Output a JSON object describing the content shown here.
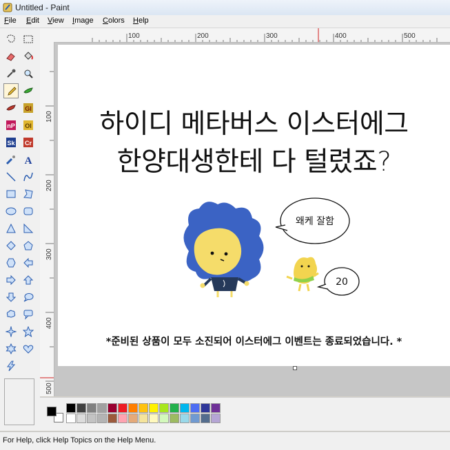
{
  "window": {
    "title": "Untitled - Paint"
  },
  "menu": [
    {
      "label": "File",
      "key": "F",
      "rest": "ile"
    },
    {
      "label": "Edit",
      "key": "E",
      "rest": "dit"
    },
    {
      "label": "View",
      "key": "V",
      "rest": "iew"
    },
    {
      "label": "Image",
      "key": "I",
      "rest": "mage"
    },
    {
      "label": "Colors",
      "key": "C",
      "rest": "olors"
    },
    {
      "label": "Help",
      "key": "H",
      "rest": "elp"
    }
  ],
  "tools": [
    {
      "name": "free-select",
      "icon": "free-select-icon"
    },
    {
      "name": "rect-select",
      "icon": "rect-select-icon"
    },
    {
      "name": "eraser",
      "icon": "eraser-icon"
    },
    {
      "name": "fill",
      "icon": "fill-bucket-icon"
    },
    {
      "name": "color-picker",
      "icon": "eyedropper-icon"
    },
    {
      "name": "magnifier",
      "icon": "magnifier-icon"
    },
    {
      "name": "pencil",
      "icon": "pencil-icon",
      "selected": true
    },
    {
      "name": "brush",
      "icon": "brush-icon"
    },
    {
      "name": "plugin-brush",
      "icon": "plugin-brush-icon"
    },
    {
      "name": "plugin-gl",
      "icon": "gl-plugin-icon",
      "text": "Gl"
    },
    {
      "name": "plugin-np",
      "icon": "np-plugin-icon",
      "text": "nP"
    },
    {
      "name": "plugin-ol",
      "icon": "ol-plugin-icon",
      "text": "Ol"
    },
    {
      "name": "plugin-sk",
      "icon": "sk-plugin-icon",
      "text": "Sk"
    },
    {
      "name": "plugin-cr",
      "icon": "cr-plugin-icon",
      "text": "Cr"
    },
    {
      "name": "airbrush",
      "icon": "airbrush-icon"
    },
    {
      "name": "text",
      "icon": "text-icon",
      "text": "A"
    },
    {
      "name": "line",
      "icon": "line-icon"
    },
    {
      "name": "curve",
      "icon": "curve-icon"
    },
    {
      "name": "rectangle",
      "icon": "rectangle-icon"
    },
    {
      "name": "polygon",
      "icon": "polygon-icon"
    },
    {
      "name": "ellipse",
      "icon": "ellipse-icon"
    },
    {
      "name": "rounded-rect",
      "icon": "rounded-rect-icon"
    },
    {
      "name": "triangle",
      "icon": "triangle-icon"
    },
    {
      "name": "right-triangle",
      "icon": "right-triangle-icon"
    },
    {
      "name": "diamond",
      "icon": "diamond-icon"
    },
    {
      "name": "pentagon",
      "icon": "pentagon-icon"
    },
    {
      "name": "hexagon",
      "icon": "hexagon-icon"
    },
    {
      "name": "arrow-left",
      "icon": "arrow-left-icon"
    },
    {
      "name": "arrow-right",
      "icon": "arrow-right-icon"
    },
    {
      "name": "arrow-up",
      "icon": "arrow-up-icon"
    },
    {
      "name": "arrow-down",
      "icon": "arrow-down-icon"
    },
    {
      "name": "callout-round",
      "icon": "callout-round-icon"
    },
    {
      "name": "callout-cloud",
      "icon": "callout-cloud-icon"
    },
    {
      "name": "callout-rect",
      "icon": "callout-rect-icon"
    },
    {
      "name": "star4",
      "icon": "star-four-icon"
    },
    {
      "name": "star5",
      "icon": "star-five-icon"
    },
    {
      "name": "star6",
      "icon": "star-six-icon"
    },
    {
      "name": "heart",
      "icon": "heart-icon"
    },
    {
      "name": "lightning",
      "icon": "lightning-icon"
    }
  ],
  "ruler": {
    "top": [
      "100",
      "200",
      "300",
      "400",
      "500"
    ],
    "left": [
      "100",
      "200",
      "300",
      "400",
      "500"
    ]
  },
  "canvas": {
    "headline_line1": "하이디 메타버스 이스터에그",
    "headline_line2": "한양대생한테 다 털렸죠?",
    "bubble1": "왜케 잘함",
    "bubble2": "20",
    "notice": "*준비된 상품이 모두 소진되어 이스터에그 이벤트는 종료되었습니다. *"
  },
  "palette": {
    "foreground": "#000000",
    "background": "#ffffff",
    "row1": [
      "#000000",
      "#404040",
      "#808080",
      "#a0a0a0",
      "#990030",
      "#ed1c24",
      "#ff7e00",
      "#ffc20e",
      "#fff200",
      "#a8e61d",
      "#22b14c",
      "#00b7ef",
      "#4d6df3",
      "#2f3699",
      "#6f3198"
    ],
    "row2": [
      "#ffffff",
      "#dcdcdc",
      "#c3c3c3",
      "#b4b4b4",
      "#9c5a3c",
      "#ffa3b1",
      "#e5aa7a",
      "#f5e49c",
      "#fff9bd",
      "#d3f9bc",
      "#9dbb61",
      "#99d9ea",
      "#709ad1",
      "#546d8e",
      "#b5a5d5"
    ]
  },
  "status": {
    "text": "For Help, click Help Topics on the Help Menu."
  },
  "colors": {
    "hair": "#3b63c4",
    "skin": "#f5dc6a",
    "shirt": "#25395a",
    "chick": "#f2d44f",
    "scarf": "#8fd14a"
  }
}
